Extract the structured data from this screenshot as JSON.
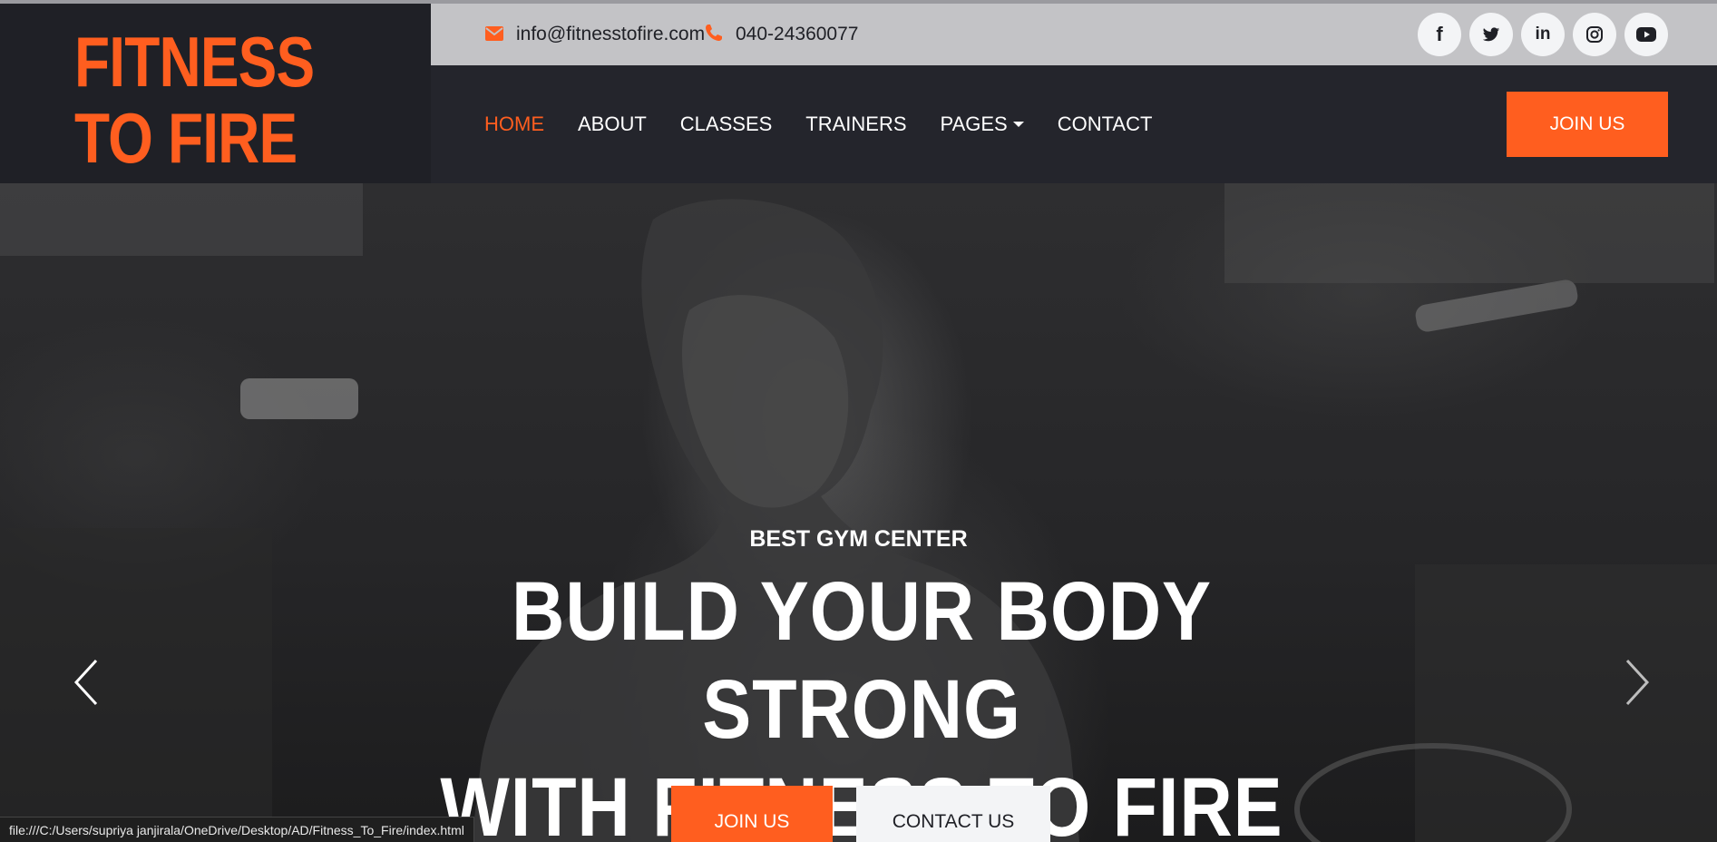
{
  "header": {
    "brand": "FITNESS TO FIRE",
    "contact": {
      "email": "info@fitnesstofire.com",
      "email_icon": "envelope-icon",
      "phone": "040-24360077",
      "phone_icon": "phone-icon"
    },
    "social": [
      {
        "icon": "facebook-icon",
        "glyph": "f"
      },
      {
        "icon": "twitter-icon",
        "glyph": ""
      },
      {
        "icon": "linkedin-icon",
        "glyph": "in"
      },
      {
        "icon": "instagram-icon",
        "glyph": ""
      },
      {
        "icon": "youtube-icon",
        "glyph": ""
      }
    ],
    "nav": [
      {
        "label": "HOME",
        "active": true
      },
      {
        "label": "ABOUT",
        "active": false
      },
      {
        "label": "CLASSES",
        "active": false
      },
      {
        "label": "TRAINERS",
        "active": false
      },
      {
        "label": "PAGES",
        "active": false,
        "dropdown": true
      },
      {
        "label": "CONTACT",
        "active": false
      }
    ],
    "join_label": "JOIN US"
  },
  "hero": {
    "kicker": "BEST GYM CENTER",
    "title_line1": "BUILD YOUR BODY STRONG",
    "title_line2": "WITH FITNESS TO FIRE",
    "primary_button": "JOIN US",
    "secondary_button": "CONTACT US",
    "prev_icon": "chevron-left-icon",
    "next_icon": "chevron-right-icon"
  },
  "status_bar": {
    "url": "file:///C:/Users/supriya janjirala/OneDrive/Desktop/AD/Fitness_To_Fire/index.html"
  },
  "colors": {
    "accent": "#ff5e1f",
    "dark": "#24252c",
    "topbar": "#c3c3c6"
  }
}
